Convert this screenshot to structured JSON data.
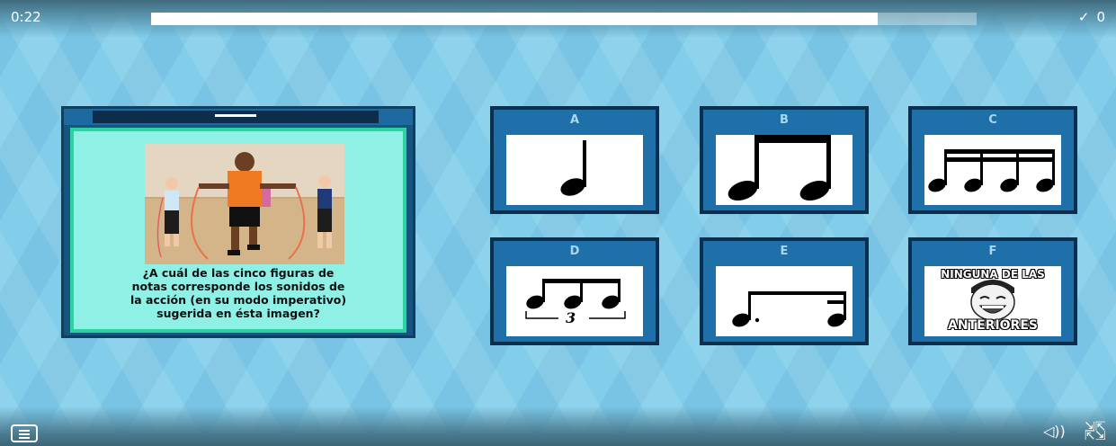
{
  "header": {
    "timer": "0:22",
    "progress_fraction": 0.88,
    "score_icon": "check-icon",
    "score": "0"
  },
  "question": {
    "image": "children-jumping-rope-photo",
    "text_lines": [
      "¿A cuál de las cinco figuras de",
      "notas corresponde los sonidos de",
      "la acción (en su modo imperativo)",
      "sugerida en ésta imagen?"
    ]
  },
  "options": [
    {
      "letter": "A",
      "image": "quarter-note"
    },
    {
      "letter": "B",
      "image": "two-eighth-notes"
    },
    {
      "letter": "C",
      "image": "four-sixteenth-notes"
    },
    {
      "letter": "D",
      "image": "eighth-note-triplet",
      "triplet_label": "3"
    },
    {
      "letter": "E",
      "image": "dotted-eighth-sixteenth"
    },
    {
      "letter": "F",
      "image": "meme-face",
      "meme_top": "NINGUNA DE LAS",
      "meme_bottom": "ANTERIORES"
    }
  ],
  "footer": {
    "menu_icon": "menu-icon",
    "sound_icon": "sound-icon",
    "collapse_icon": "collapse-icon"
  },
  "colors": {
    "background": "#82cdea",
    "card_border": "#0b2f4c",
    "card_header": "#1f6fa8",
    "question_panel": "#8ff0e6",
    "question_border": "#2ad39f"
  }
}
